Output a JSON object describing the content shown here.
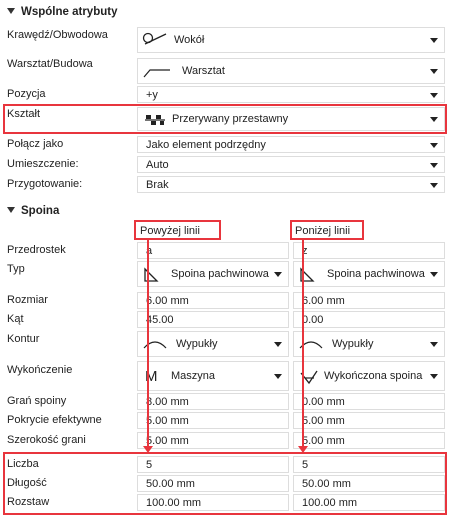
{
  "common": {
    "title": "Wspólne atrybuty",
    "rows": [
      {
        "label": "Krawędź/Obwodowa",
        "value": "Wokół",
        "icon": "pin-line-icon"
      },
      {
        "label": "Warsztat/Budowa",
        "value": "Warsztat",
        "icon": "flag-line-icon"
      },
      {
        "label": "Pozycja",
        "value": "+y"
      },
      {
        "label": "Kształt",
        "value": "Przerywany przestawny",
        "icon": "staggered-weld-icon"
      },
      {
        "label": "Połącz jako",
        "value": "Jako element podrzędny"
      },
      {
        "label": "Umieszczenie:",
        "value": "Auto"
      },
      {
        "label": "Przygotowanie:",
        "value": "Brak"
      }
    ]
  },
  "weld": {
    "title": "Spoina",
    "col_above": "Powyżej linii",
    "col_below": "Poniżej linii",
    "rows": [
      {
        "label": "Przedrostek",
        "above": "a",
        "below": "z"
      },
      {
        "label": "Typ",
        "above": "Spoina pachwinowa",
        "below": "Spoina pachwinowa"
      },
      {
        "label": "Rozmiar",
        "above": "6.00 mm",
        "below": "6.00 mm"
      },
      {
        "label": "Kąt",
        "above": "45.00",
        "below": "0.00"
      },
      {
        "label": "Kontur",
        "above": "Wypukły",
        "below": "Wypukły"
      },
      {
        "label": "Wykończenie",
        "above": "Maszyna",
        "below": "Wykończona spoina"
      },
      {
        "label": "Grań spoiny",
        "above": "8.00 mm",
        "below": "0.00 mm"
      },
      {
        "label": "Pokrycie efektywne",
        "above": "5.00 mm",
        "below": "5.00 mm"
      },
      {
        "label": "Szerokość grani",
        "above": "5.00 mm",
        "below": "5.00 mm"
      },
      {
        "label": "Liczba",
        "above": "5",
        "below": "5"
      },
      {
        "label": "Długość",
        "above": "50.00 mm",
        "below": "50.00 mm"
      },
      {
        "label": "Rozstaw",
        "above": "100.00 mm",
        "below": "100.00 mm"
      }
    ]
  },
  "colors": {
    "highlight": "#e8353d"
  }
}
